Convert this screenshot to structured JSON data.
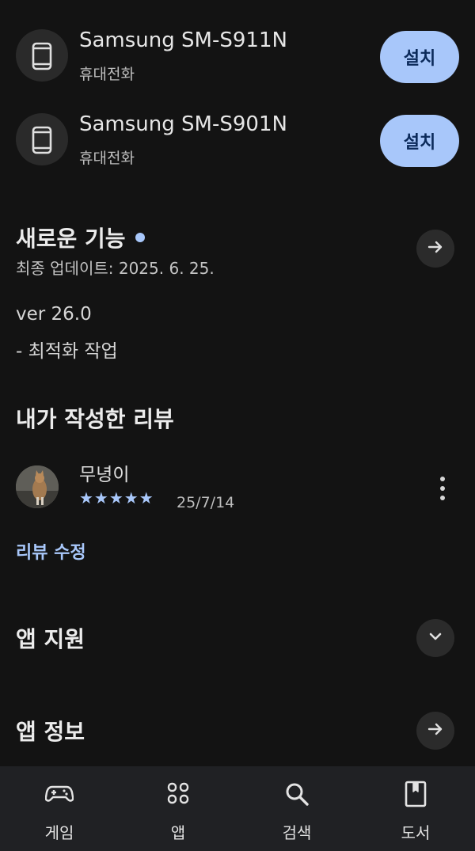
{
  "devices": [
    {
      "name": "Samsung SM-S911N",
      "type": "휴대전화",
      "button": "설치",
      "icon": "phone-icon"
    },
    {
      "name": "Samsung SM-S901N",
      "type": "휴대전화",
      "button": "설치",
      "icon": "phone-icon"
    }
  ],
  "whats_new": {
    "title": "새로운 기능",
    "updated": "최종 업데이트: 2025. 6. 25.",
    "version": "ver 26.0",
    "note": "- 최적화 작업",
    "icon": "arrow-right-icon"
  },
  "my_review": {
    "title": "내가 작성한 리뷰",
    "reviewer": "무녕이",
    "stars": "★★★★★",
    "rating": 5,
    "date": "25/7/14",
    "edit_label": "리뷰 수정",
    "menu_icon": "more-vert-icon"
  },
  "app_support": {
    "title": "앱 지원",
    "icon": "chevron-down-icon"
  },
  "app_info": {
    "title": "앱 정보",
    "icon": "arrow-right-icon"
  },
  "nav": [
    {
      "label": "게임",
      "icon": "gamepad-icon"
    },
    {
      "label": "앱",
      "icon": "apps-grid-icon"
    },
    {
      "label": "검색",
      "icon": "search-icon"
    },
    {
      "label": "도서",
      "icon": "book-icon"
    }
  ],
  "colors": {
    "background": "#131313",
    "accent": "#a8c7fa",
    "nav_background": "#202124"
  }
}
